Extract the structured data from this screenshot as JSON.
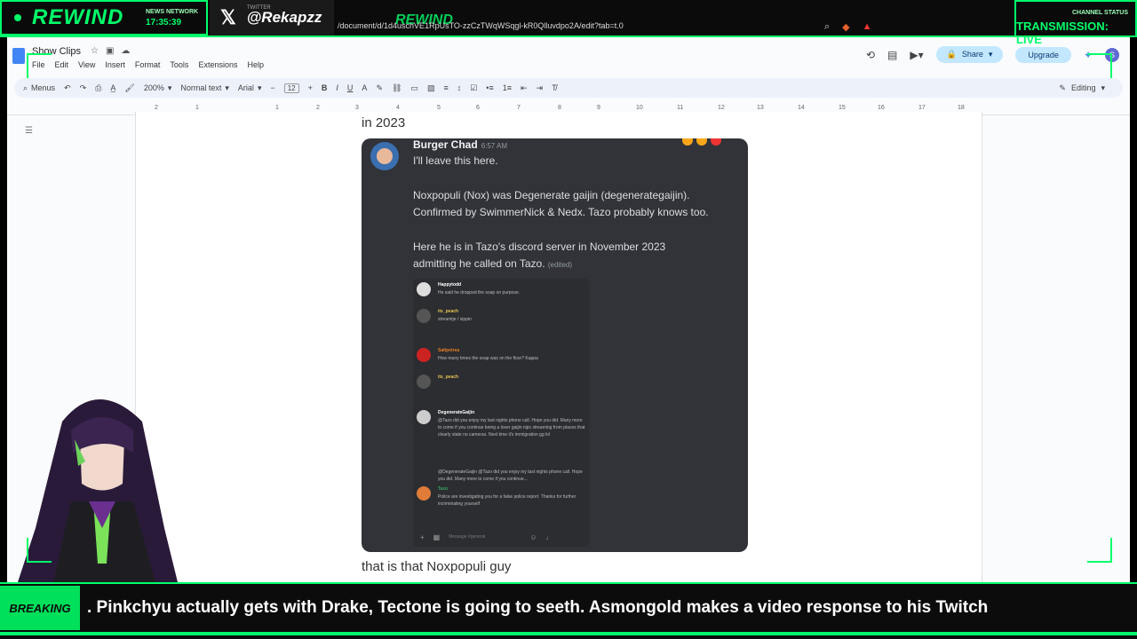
{
  "overlay": {
    "brand": "REWIND",
    "network_label": "NEWS NETWORK",
    "clock": "17:35:39",
    "twitter_label": "TWITTER",
    "twitter_handle": "@Rekapzz",
    "center_brand": "REWIND",
    "status_label": "CHANNEL STATUS",
    "status_text": "TRANSMISSION: LIVE",
    "accent_color": "#00ff6a"
  },
  "browser": {
    "url": "/document/d/1d4uschVE1RpUsTO-zzCzTWqWSqgl-kR0Qlluvdpo2A/edit?tab=t.0"
  },
  "doc": {
    "title": "Show Clips",
    "menus": [
      "File",
      "Edit",
      "View",
      "Insert",
      "Format",
      "Tools",
      "Extensions",
      "Help"
    ],
    "share_label": "Share",
    "upgrade_label": "Upgrade",
    "avatar_letter": "S",
    "toolbar": {
      "menus_label": "Menus",
      "zoom": "200%",
      "style": "Normal text",
      "font": "Arial",
      "font_size": "12",
      "editing_label": "Editing"
    },
    "ruler": [
      "2",
      "1",
      "1",
      "2",
      "3",
      "4",
      "5",
      "6",
      "7",
      "8",
      "9",
      "10",
      "11",
      "12",
      "13",
      "14",
      "15",
      "16",
      "17",
      "18"
    ],
    "para_before": "in 2023",
    "para_after": "that is that Noxpopuli guy"
  },
  "discord": {
    "username": "Burger Chad",
    "timestamp": "6:57 AM",
    "line1": "I'll leave this here.",
    "line2": "Noxpopuli (Nox) was Degenerate gaijin (degenerategaijin).",
    "line3": "Confirmed by SwimmerNick & Nedx. Tazo probably knows too.",
    "line4": "Here he is in Tazo's discord server in November 2023",
    "line5": "admitting he called on Tazo.",
    "edited": "(edited)",
    "embed_messages": [
      {
        "user": "Happytodd",
        "text": "He said he dropped the soap on purpose."
      },
      {
        "user": "its_peach",
        "text": "streamtje / sippin"
      },
      {
        "user": "Saltpetrea",
        "text": "How many times the soap was on the floor? Kappa"
      },
      {
        "user": "its_peach",
        "text": ""
      },
      {
        "user": "DegenerateGaijin",
        "text": "@Tazo did you enjoy my last nights phone call. Hope you did. Many more to come if you continue being a loser gaijin nipc streaming from places that clearly state no cameras. Next time it's immigration gg lol"
      },
      {
        "user": "Tazo",
        "text": "Police are investigating you for a false police report. Thanks for further incriminating yourself"
      }
    ],
    "embed_reply": "@DegenerateGaijin @Tazo did you enjoy my last nights phone call. Hope you did. Many more to come if you continue...",
    "embed_input": "Message #general"
  },
  "ticker": {
    "label": "BREAKING",
    "text": ". Pinkchyu actually gets with Drake, Tectone is going to seeth. Asmongold makes a video response to his Twitch"
  }
}
